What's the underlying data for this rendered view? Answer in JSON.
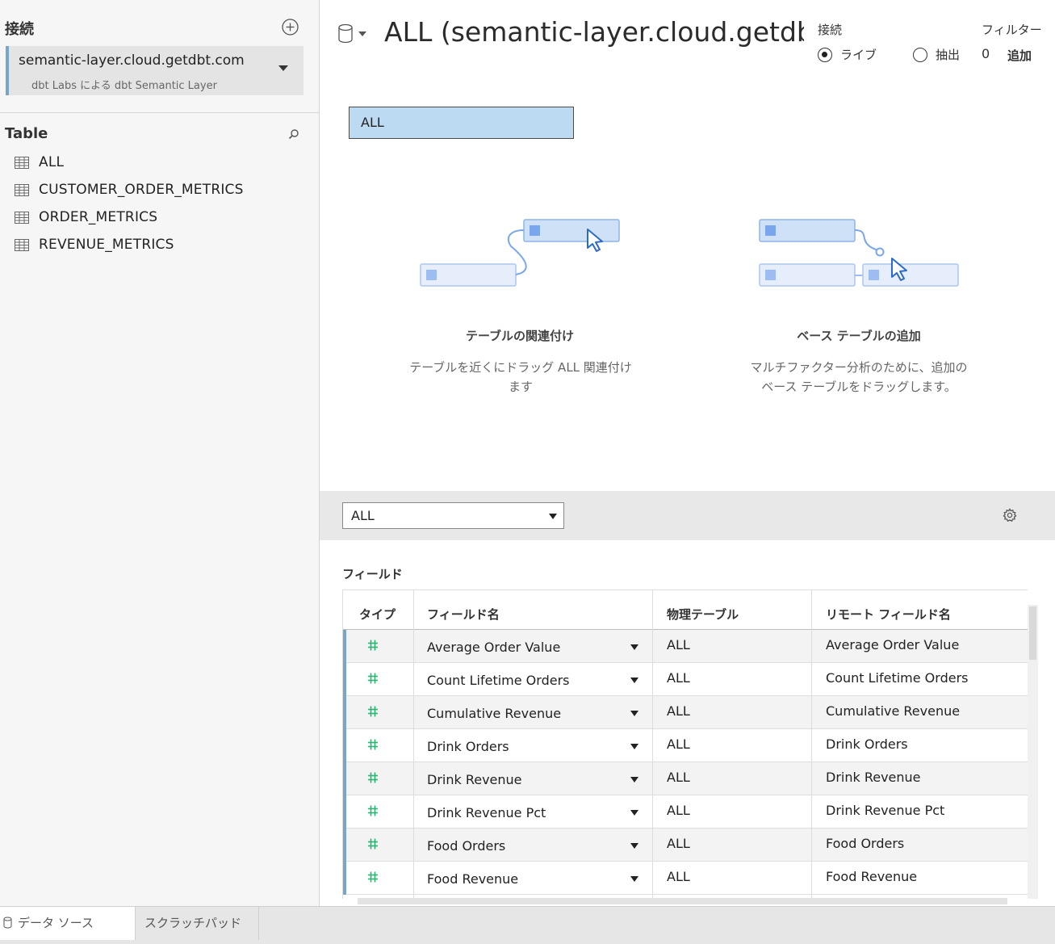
{
  "sidebar": {
    "connections_title": "接続",
    "connection": {
      "name": "semantic-layer.cloud.getdbt.com",
      "subtitle": "dbt Labs による dbt Semantic Layer"
    },
    "table_title": "Table",
    "tables": [
      {
        "label": "ALL"
      },
      {
        "label": "CUSTOMER_ORDER_METRICS"
      },
      {
        "label": "ORDER_METRICS"
      },
      {
        "label": "REVENUE_METRICS"
      }
    ]
  },
  "header": {
    "datasource_title": "ALL (semantic-layer.cloud.getdbt.com)",
    "connection_label": "接続",
    "radio_live": "ライブ",
    "radio_extract": "抽出",
    "filters_label": "フィルター",
    "filters_count": "0",
    "filters_add": "追加"
  },
  "canvas": {
    "table_label": "ALL",
    "hint_relate": {
      "title": "テーブルの関連付け",
      "text": "テーブルを近くにドラッグ ALL 関連付けます"
    },
    "hint_base": {
      "title": "ベース テーブルの追加",
      "text": "マルチファクター分析のために、追加のベース テーブルをドラッグします。"
    }
  },
  "grid_toolbar": {
    "selected_table": "ALL"
  },
  "fields": {
    "title": "フィールド",
    "columns": [
      "タイプ",
      "フィールド名",
      "物理テーブル",
      "リモート フィールド名"
    ],
    "rows": [
      {
        "type_icon": "number-icon",
        "name": "Average Order Value",
        "table": "ALL",
        "remote": "Average Order Value"
      },
      {
        "type_icon": "number-icon",
        "name": "Count Lifetime Orders",
        "table": "ALL",
        "remote": "Count Lifetime Orders"
      },
      {
        "type_icon": "number-icon",
        "name": "Cumulative Revenue",
        "table": "ALL",
        "remote": "Cumulative Revenue"
      },
      {
        "type_icon": "number-icon",
        "name": "Drink Orders",
        "table": "ALL",
        "remote": "Drink Orders"
      },
      {
        "type_icon": "number-icon",
        "name": "Drink Revenue",
        "table": "ALL",
        "remote": "Drink Revenue"
      },
      {
        "type_icon": "number-icon",
        "name": "Drink Revenue Pct",
        "table": "ALL",
        "remote": "Drink Revenue Pct"
      },
      {
        "type_icon": "number-icon",
        "name": "Food Orders",
        "table": "ALL",
        "remote": "Food Orders"
      },
      {
        "type_icon": "number-icon",
        "name": "Food Revenue",
        "table": "ALL",
        "remote": "Food Revenue"
      }
    ]
  },
  "tabs": {
    "datasource": "データ ソース",
    "scratchpad": "スクラッチパッド"
  },
  "colors": {
    "accent": "#79a6c6",
    "table_fill": "#bcdaf2",
    "number_green": "#2bb673"
  }
}
